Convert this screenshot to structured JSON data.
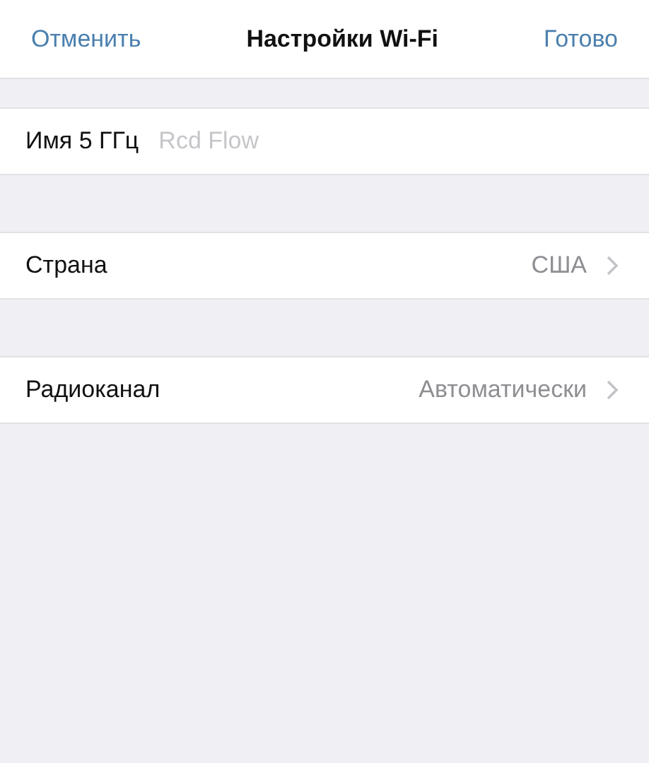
{
  "nav_bar": {
    "cancel": "Отменить",
    "title": "Настройки Wi-Fi",
    "done": "Готово"
  },
  "rows": [
    {
      "kind": "field",
      "label": "Имя 5 ГГц",
      "placeholder": "Rcd Flow"
    },
    {
      "kind": "link",
      "label": "Страна",
      "value": "США"
    },
    {
      "kind": "link",
      "label": "Радиоканал",
      "value": "Автоматически"
    }
  ]
}
